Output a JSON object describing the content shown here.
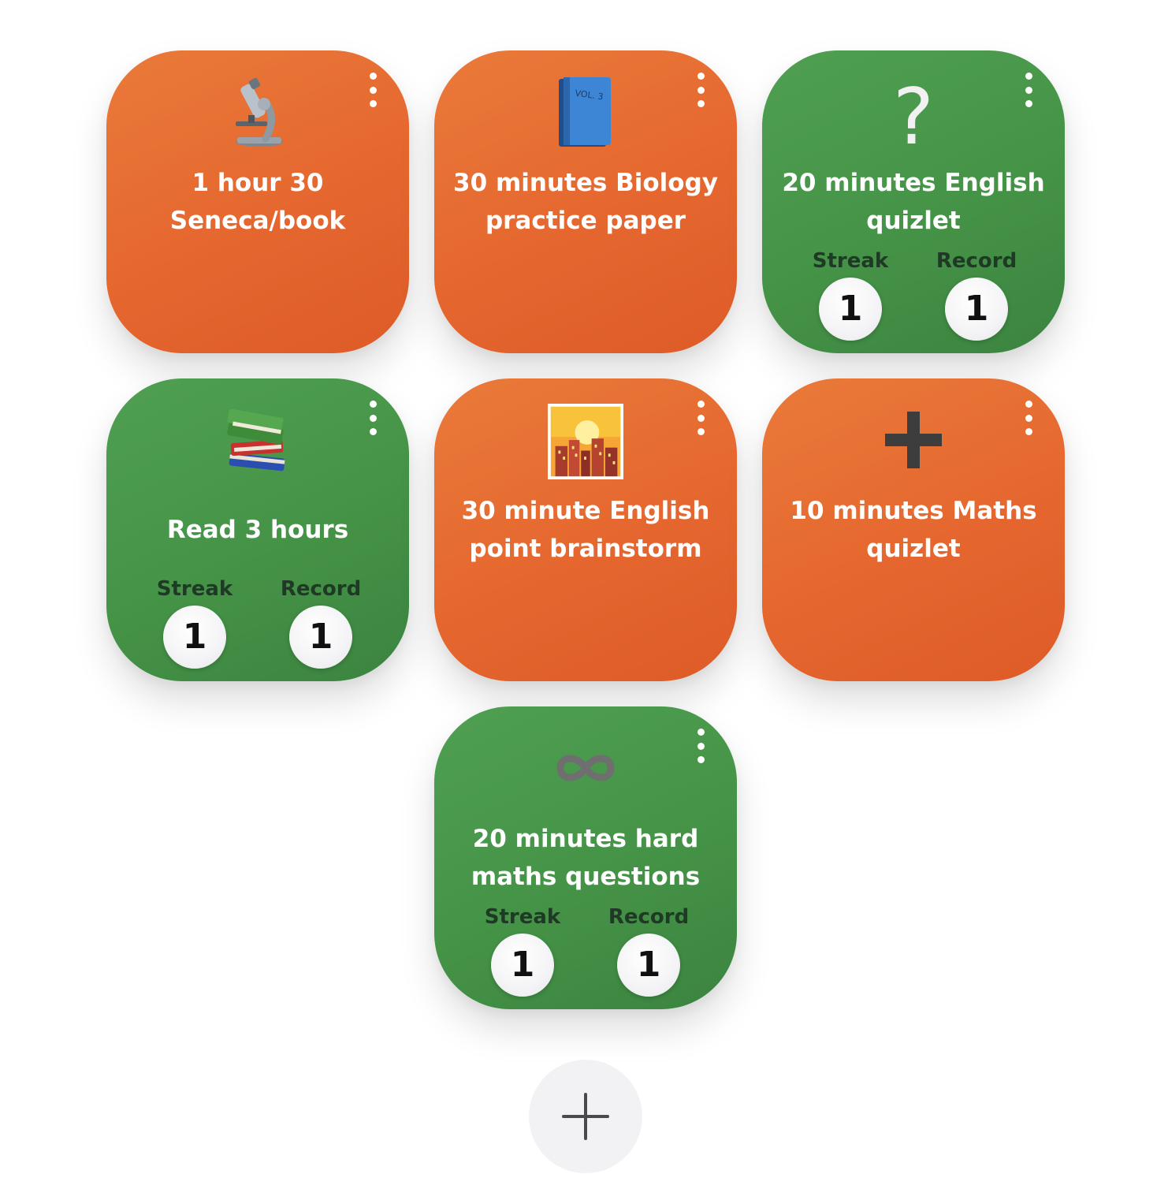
{
  "cards": [
    {
      "title_lines": [
        "1 hour 30",
        "Seneca/book"
      ],
      "icon": "microscope-icon",
      "color": "orange"
    },
    {
      "title_lines": [
        "30 minutes Biology",
        "practice paper"
      ],
      "icon": "blue-book-icon",
      "icon_text": "VOL. 3",
      "color": "orange"
    },
    {
      "title_lines": [
        "20 minutes English",
        "quizlet"
      ],
      "icon": "question-mark-icon",
      "icon_text": "?",
      "color": "green",
      "streak_label": "Streak",
      "streak": "1",
      "record_label": "Record",
      "record": "1"
    },
    {
      "title_lines": [
        "Read 3 hours"
      ],
      "icon": "books-stack-icon",
      "color": "green",
      "streak_label": "Streak",
      "streak": "1",
      "record_label": "Record",
      "record": "1"
    },
    {
      "title_lines": [
        "30 minute English",
        "point brainstorm"
      ],
      "icon": "city-sunset-icon",
      "color": "orange"
    },
    {
      "title_lines": [
        "10 minutes Maths",
        "quizlet"
      ],
      "icon": "plus-sign-icon",
      "color": "orange"
    },
    {
      "title_lines": [
        "20 minutes hard",
        "maths questions"
      ],
      "icon": "infinity-icon",
      "color": "green",
      "streak_label": "Streak",
      "streak": "1",
      "record_label": "Record",
      "record": "1"
    }
  ],
  "colors": {
    "orange": "#e5672f",
    "green": "#459347",
    "add_button_bg": "#f2f2f4"
  },
  "add_button": {
    "icon": "plus-icon"
  }
}
